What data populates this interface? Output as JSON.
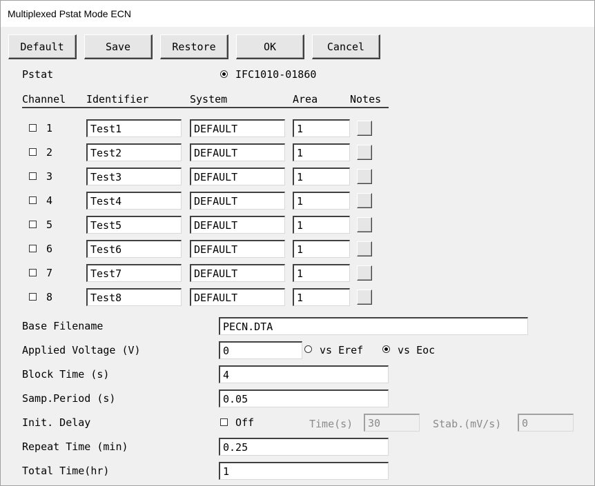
{
  "window": {
    "title": "Multiplexed Pstat Mode ECN"
  },
  "toolbar": {
    "default_label": "Default",
    "save_label": "Save",
    "restore_label": "Restore",
    "ok_label": "OK",
    "cancel_label": "Cancel"
  },
  "pstat": {
    "label": "Pstat",
    "option": "IFC1010-01860",
    "selected": true
  },
  "table": {
    "headers": {
      "channel": "Channel",
      "identifier": "Identifier",
      "system": "System",
      "area": "Area",
      "notes": "Notes"
    },
    "rows": [
      {
        "channel": "1",
        "identifier": "Test1",
        "system": "DEFAULT",
        "area": "1",
        "checked": false
      },
      {
        "channel": "2",
        "identifier": "Test2",
        "system": "DEFAULT",
        "area": "1",
        "checked": false
      },
      {
        "channel": "3",
        "identifier": "Test3",
        "system": "DEFAULT",
        "area": "1",
        "checked": false
      },
      {
        "channel": "4",
        "identifier": "Test4",
        "system": "DEFAULT",
        "area": "1",
        "checked": false
      },
      {
        "channel": "5",
        "identifier": "Test5",
        "system": "DEFAULT",
        "area": "1",
        "checked": false
      },
      {
        "channel": "6",
        "identifier": "Test6",
        "system": "DEFAULT",
        "area": "1",
        "checked": false
      },
      {
        "channel": "7",
        "identifier": "Test7",
        "system": "DEFAULT",
        "area": "1",
        "checked": false
      },
      {
        "channel": "8",
        "identifier": "Test8",
        "system": "DEFAULT",
        "area": "1",
        "checked": false
      }
    ]
  },
  "params": {
    "base_filename": {
      "label": "Base Filename",
      "value": "PECN.DTA"
    },
    "applied_voltage": {
      "label": "Applied Voltage (V)",
      "value": "0",
      "vs_eref": "vs Eref",
      "vs_eoc": "vs Eoc",
      "selected": "vs_eoc"
    },
    "block_time": {
      "label": "Block Time (s)",
      "value": "4"
    },
    "samp_period": {
      "label": "Samp.Period (s)",
      "value": "0.05"
    },
    "init_delay": {
      "label": "Init. Delay",
      "toggle_label": "Off",
      "checked": false,
      "time_label": "Time(s)",
      "time_value": "30",
      "stab_label": "Stab.(mV/s)",
      "stab_value": "0"
    },
    "repeat_time": {
      "label": "Repeat Time (min)",
      "value": "0.25"
    },
    "total_time": {
      "label": "Total Time(hr)",
      "value": "1"
    }
  }
}
